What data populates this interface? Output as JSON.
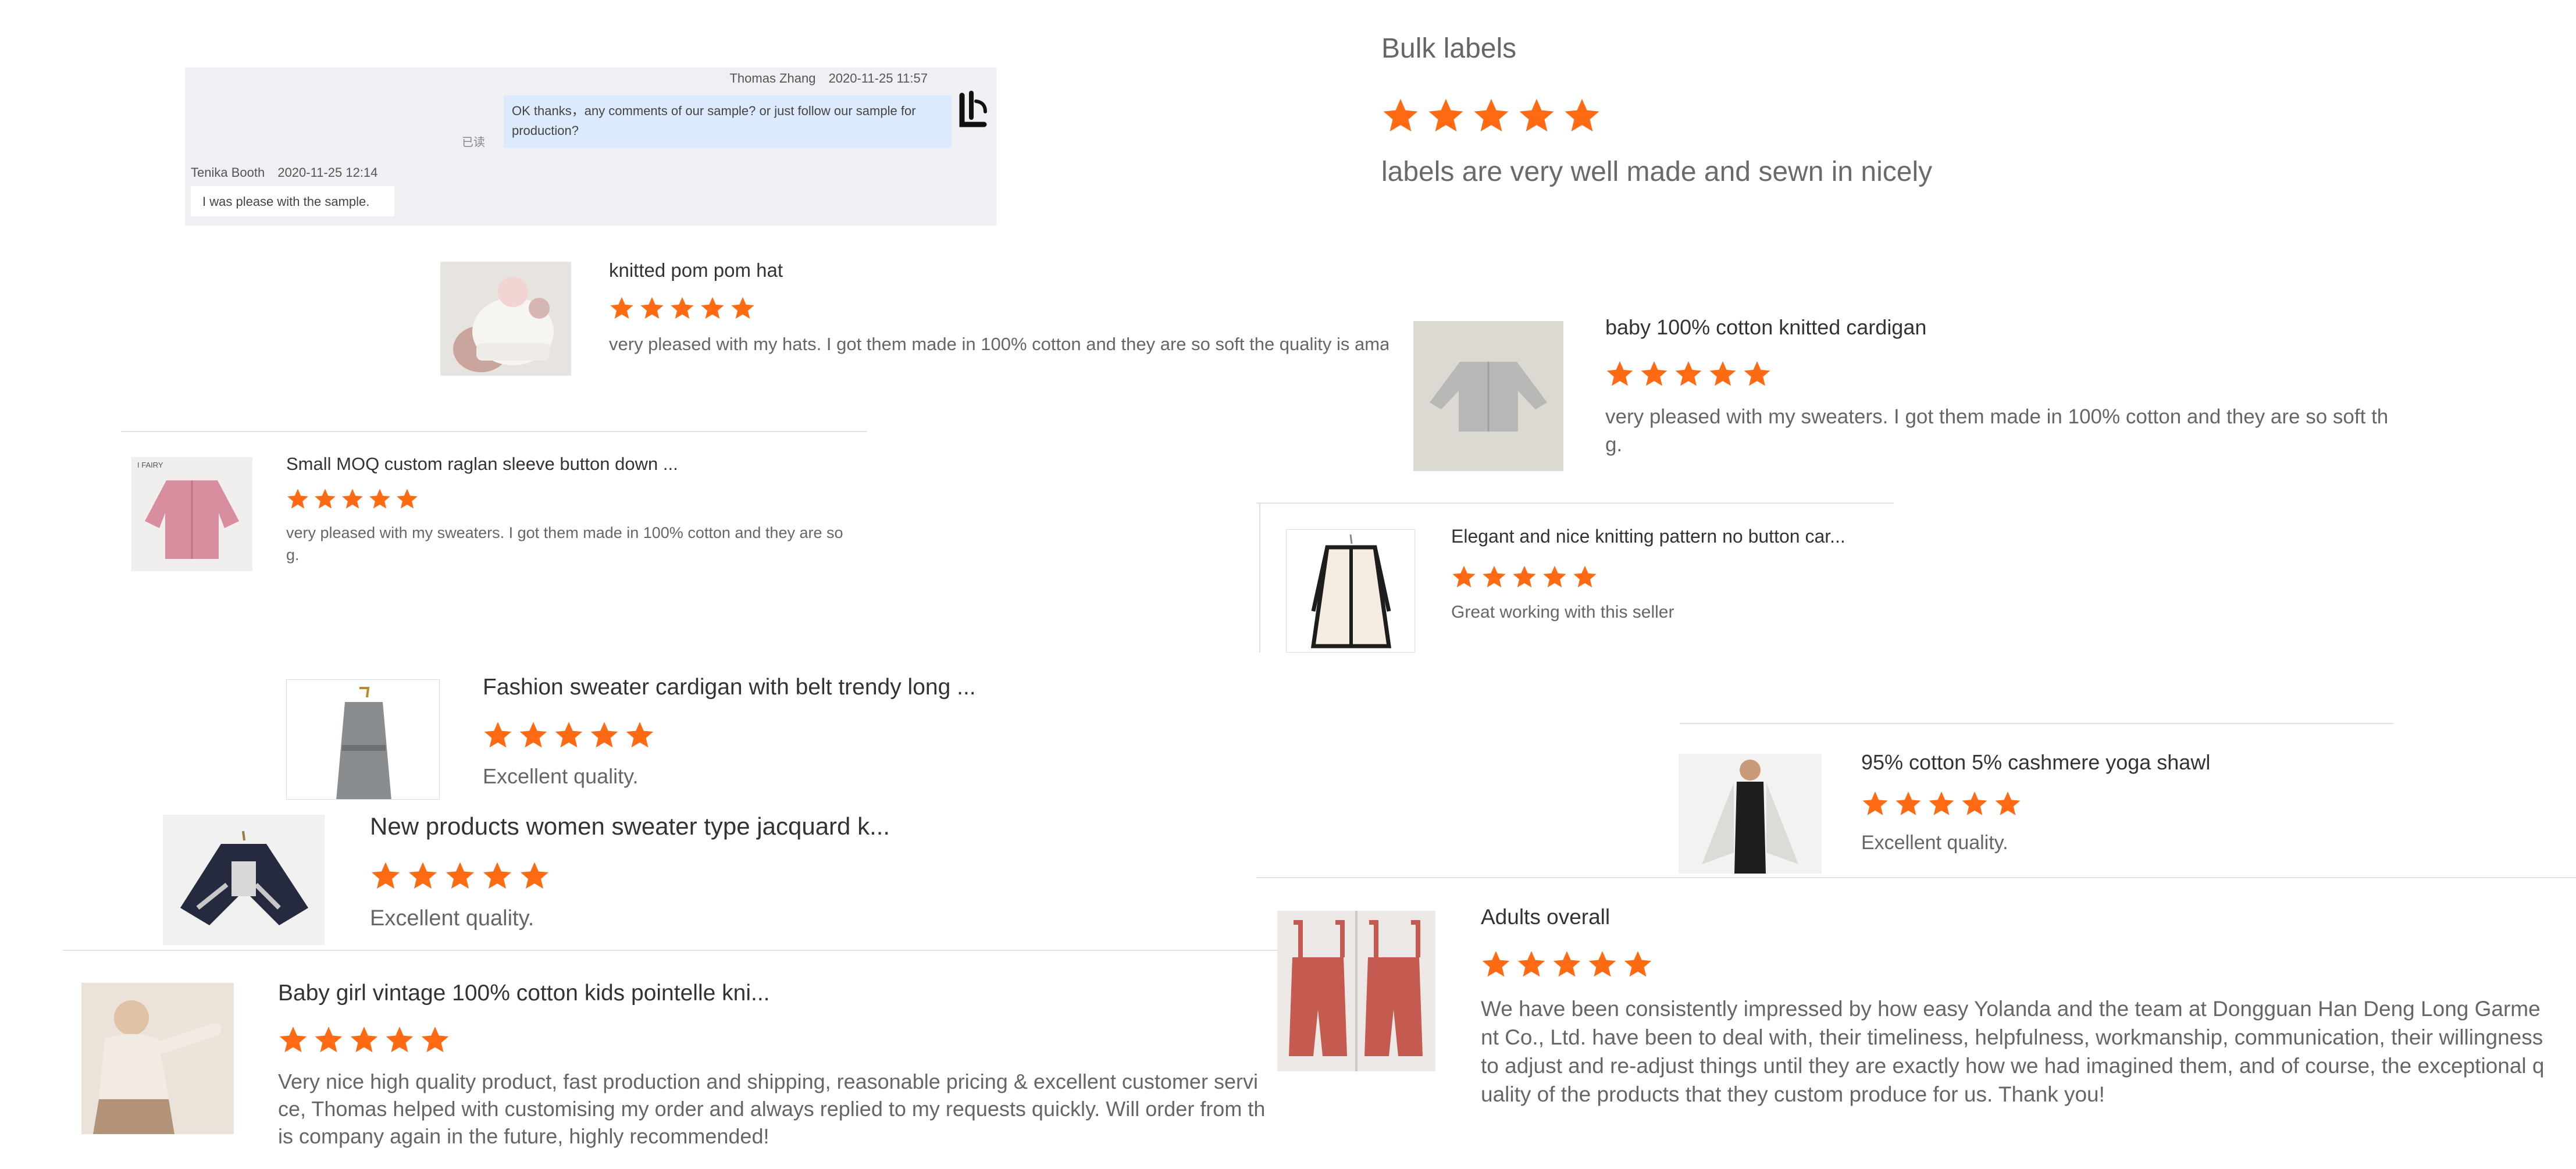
{
  "chat": {
    "seller_name": "Thomas Zhang",
    "seller_time": "2020-11-25 11:57",
    "seller_message": "OK thanks，any comments of our sample? or just follow our sample for production?",
    "read_status": "已读",
    "buyer_name": "Tenika Booth",
    "buyer_time": "2020-11-25 12:14",
    "buyer_message": "I was please with the sample."
  },
  "reviews": [
    {
      "title": "knitted pom pom hat",
      "rating": 5,
      "text": "very pleased with my hats. I got them made in 100% cotton and they are so soft the quality is ama"
    },
    {
      "title": "Small MOQ custom raglan sleeve button down ...",
      "rating": 5,
      "text": "very pleased with my sweaters. I got them made in 100% cotton and they are so",
      "text2": "g.",
      "thumb_label": "I FAIRY"
    },
    {
      "title": "Fashion sweater cardigan with belt trendy long ...",
      "rating": 5,
      "text": "Excellent quality."
    },
    {
      "title": "New products women sweater type jacquard k...",
      "rating": 5,
      "text": "Excellent quality."
    },
    {
      "title": "Baby girl vintage 100% cotton kids pointelle kni...",
      "rating": 5,
      "text": "Very nice high quality product, fast production and shipping, reasonable pricing & excellent customer service, Thomas helped with customising my order and always replied to my requests quickly. Will order from this company again in the future, highly recommended!"
    },
    {
      "title": "Bulk labels",
      "rating": 5,
      "text": "labels are very well made and sewn in nicely"
    },
    {
      "title": "baby 100% cotton knitted cardigan",
      "rating": 5,
      "text": "very pleased with my sweaters. I got them made in 100% cotton and they are so soft th",
      "text2": "g."
    },
    {
      "title": "Elegant and nice knitting pattern no button car...",
      "rating": 5,
      "text": "Great working with this seller"
    },
    {
      "title": "95% cotton 5% cashmere yoga shawl",
      "rating": 5,
      "text": "Excellent quality."
    },
    {
      "title": "Adults overall",
      "rating": 5,
      "text": "We have been consistently impressed by how easy Yolanda and the team at Dongguan Han Deng Long Garment Co., Ltd. have been to deal with, their timeliness, helpfulness, workmanship, communication, their willingness to adjust and re-adjust things until they are exactly how we had imagined them, and of course, the exceptional quality of the products that they custom produce for us. Thank you!"
    }
  ],
  "colors": {
    "star": "#ff6a13",
    "chat_bg": "#eef0f4",
    "seller_bubble": "#dbeafc"
  },
  "icons": {
    "star": "star-icon",
    "avatar": "company-logo-avatar"
  }
}
